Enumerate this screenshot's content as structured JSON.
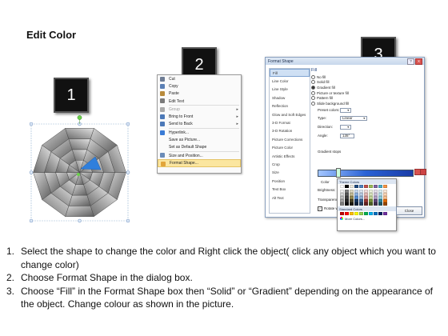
{
  "page": {
    "title": "Edit Color"
  },
  "badges": [
    "1",
    "2",
    "3"
  ],
  "context_menu": {
    "items": [
      {
        "label": "Cut",
        "icon": "scissors-icon",
        "color": "#6f7d95"
      },
      {
        "label": "Copy",
        "icon": "copy-icon",
        "color": "#5b7fb5"
      },
      {
        "label": "Paste",
        "icon": "paste-icon",
        "color": "#b88a3b"
      },
      {
        "label": "Edit Text",
        "icon": "edit-text-icon",
        "color": "#7a7a7a"
      },
      {
        "label": "Group",
        "icon": "group-icon",
        "color": "#aaaaaa",
        "disabled": true,
        "submenu": true
      },
      {
        "label": "Bring to Front",
        "icon": "bring-front-icon",
        "color": "#4c79b8",
        "submenu": true
      },
      {
        "label": "Send to Back",
        "icon": "send-back-icon",
        "color": "#4c79b8",
        "submenu": true
      },
      {
        "label": "Hyperlink...",
        "icon": "hyperlink-icon",
        "color": "#3a7bd5"
      },
      {
        "label": "Save as Picture...",
        "icon": "",
        "color": ""
      },
      {
        "label": "Set as Default Shape",
        "icon": "",
        "color": ""
      },
      {
        "label": "Size and Position...",
        "icon": "size-position-icon",
        "color": "#6b8cb8"
      },
      {
        "label": "Format Shape...",
        "icon": "format-shape-icon",
        "color": "#e2a53a",
        "highlight": true
      }
    ]
  },
  "dialog": {
    "title": "Format Shape",
    "help": "?",
    "close": "X",
    "nav": [
      "Fill",
      "Line Color",
      "Line Style",
      "Shadow",
      "Reflection",
      "Glow and Soft Edges",
      "3-D Format",
      "3-D Rotation",
      "Picture Corrections",
      "Picture Color",
      "Artistic Effects",
      "Crop",
      "Size",
      "Position",
      "Text Box",
      "Alt Text"
    ],
    "selected_nav": "Fill",
    "panel": {
      "heading": "Fill",
      "options": [
        {
          "label": "No fill",
          "selected": false
        },
        {
          "label": "Solid fill",
          "selected": false
        },
        {
          "label": "Gradient fill",
          "selected": true
        },
        {
          "label": "Picture or texture fill",
          "selected": false
        },
        {
          "label": "Pattern fill",
          "selected": false
        },
        {
          "label": "Slide background fill",
          "selected": false
        }
      ],
      "preset_colors_label": "Preset colors:",
      "type_label": "Type:",
      "type_value": "Linear",
      "direction_label": "Direction:",
      "angle_label": "Angle:",
      "angle_value": "135°",
      "gradient_stops_label": "Gradient stops",
      "color_label": "Color",
      "position_label": "Position:",
      "position_value": "24%",
      "brightness_label": "Brightness:",
      "transparency_label": "Transparency:",
      "rotate_label": "Rotate with shape"
    },
    "close_button": "Close"
  },
  "color_flyout": {
    "theme_heading": "Theme Colors",
    "standard_heading": "Standard Colors",
    "more_label": "More Colors...",
    "theme_top": [
      "#ffffff",
      "#000000",
      "#eeece1",
      "#1f497d",
      "#4f81bd",
      "#c0504d",
      "#9bbb59",
      "#8064a2",
      "#4bacc6",
      "#f79646"
    ],
    "theme_shades": [
      [
        "#f2f2f2",
        "#7f7f7f",
        "#ddd9c3",
        "#c6d9f0",
        "#dbe5f1",
        "#f2dcdb",
        "#ebf1dd",
        "#e5e0ec",
        "#dbeef3",
        "#fdeada"
      ],
      [
        "#d8d8d8",
        "#595959",
        "#c4bd97",
        "#8db3e2",
        "#b8cce4",
        "#e5b9b7",
        "#d7e3bc",
        "#ccc1d9",
        "#b7dde8",
        "#fbd5b5"
      ],
      [
        "#bfbfbf",
        "#3f3f3f",
        "#938953",
        "#548dd4",
        "#95b3d7",
        "#d99694",
        "#c3d69b",
        "#b2a2c7",
        "#92cddc",
        "#fac08f"
      ],
      [
        "#a5a5a5",
        "#262626",
        "#494429",
        "#17365d",
        "#366092",
        "#953734",
        "#76923c",
        "#5f497a",
        "#31859b",
        "#e36c09"
      ],
      [
        "#7f7f7f",
        "#0c0c0c",
        "#1d1b10",
        "#0f243e",
        "#244061",
        "#632423",
        "#4f6128",
        "#3f3151",
        "#205867",
        "#974806"
      ]
    ],
    "standard": [
      "#c00000",
      "#ff0000",
      "#ffc000",
      "#ffff00",
      "#92d050",
      "#00b050",
      "#00b0f0",
      "#0070c0",
      "#002060",
      "#7030a0"
    ]
  },
  "instructions": [
    {
      "num": "1.",
      "text": "Select the shape to change the color and Right click the object( click any object which you want to change color)"
    },
    {
      "num": "2.",
      "text": "Choose Format Shape in the dialog box."
    },
    {
      "num": "3.",
      "text": "Choose “Fill” in the Format Shape box then “Solid” or “Gradient” depending on the appearance of the object. Change colour as shown in the picture."
    }
  ]
}
